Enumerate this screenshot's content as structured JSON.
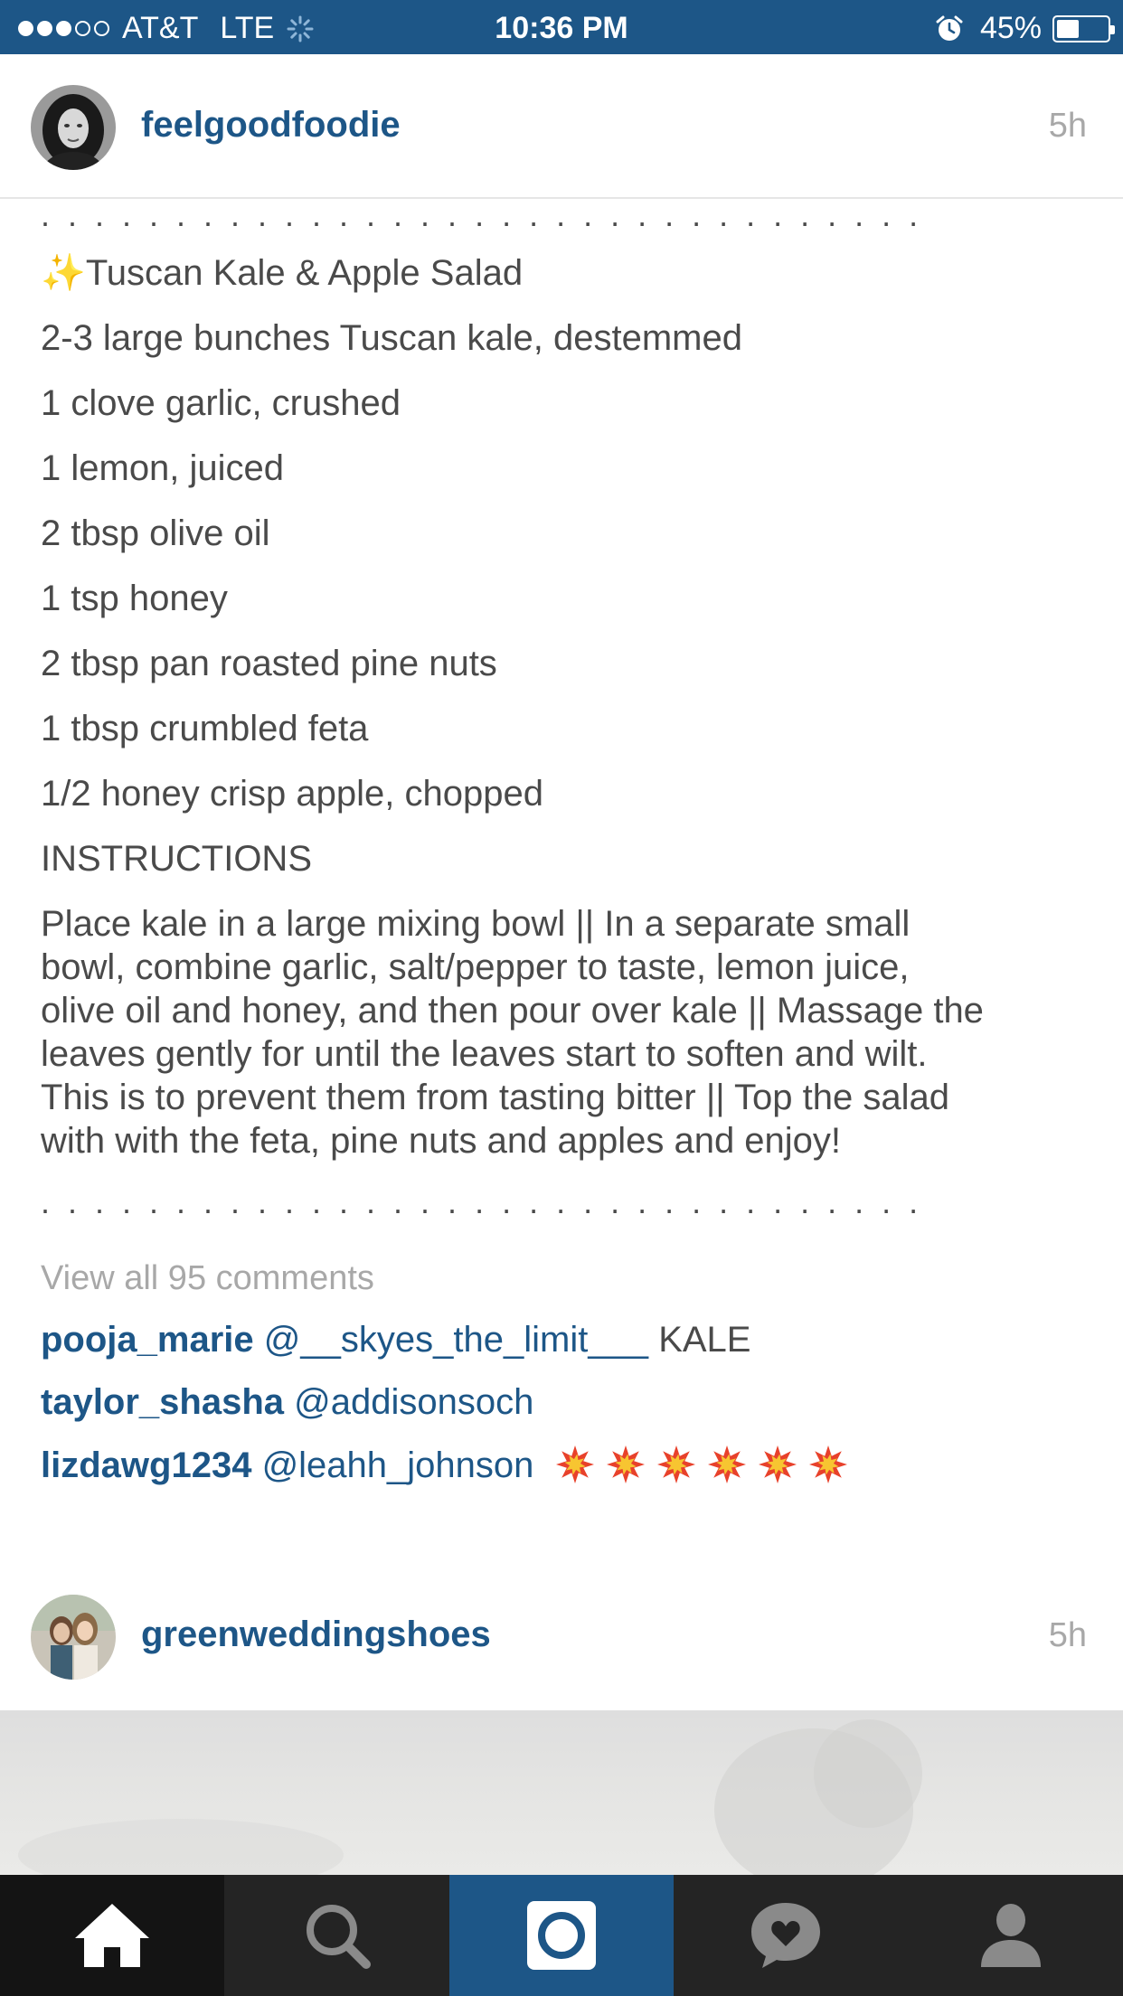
{
  "status_bar": {
    "signal_bars_filled": 3,
    "signal_bars_total": 5,
    "carrier": "AT&T",
    "network": "LTE",
    "time": "10:36 PM",
    "battery": "45%",
    "battery_level": 0.45,
    "icons": [
      "activity-spinner-icon",
      "alarm-clock-icon",
      "battery-icon"
    ]
  },
  "post": {
    "username": "feelgoodfoodie",
    "time_ago": "5h",
    "caption": {
      "dots": ". . . . . . . . . . . . . . . . . . . . . . . . . . . . . . . . .",
      "title_emoji": "✨",
      "title": "Tuscan Kale & Apple Salad",
      "ingredients": [
        "2-3 large bunches Tuscan kale, destemmed",
        "1 clove garlic, crushed",
        "1 lemon, juiced",
        "2 tbsp olive oil",
        "1 tsp honey",
        "2 tbsp pan roasted pine nuts",
        "1 tbsp crumbled feta",
        "1/2 honey crisp apple, chopped"
      ],
      "instructions_heading": "INSTRUCTIONS",
      "instructions_lines": [
        "Place kale in a large mixing bowl || In a separate small",
        "bowl, combine garlic, salt/pepper to taste, lemon juice,",
        "olive oil and honey, and then pour over kale || Massage the",
        "leaves gently for until the leaves start to soften and wilt.",
        "This is to prevent them from tasting bitter || Top the salad",
        "with with the feta, pine nuts and apples and enjoy!"
      ]
    },
    "view_all_comments": "View all 95 comments",
    "comments": [
      {
        "user": "pooja_marie",
        "mention": "@__skyes_the_limit___",
        "text": "KALE"
      },
      {
        "user": "taylor_shasha",
        "mention": "@addisonsoch",
        "text": ""
      },
      {
        "user": "lizdawg1234",
        "mention": "@leahh_johnson",
        "text": "",
        "emoji_count": 6,
        "emoji": "collision-icon"
      }
    ]
  },
  "next_post": {
    "username": "greenweddingshoes",
    "time_ago": "5h"
  },
  "tab_bar": {
    "tabs": [
      {
        "name": "home",
        "icon": "home-icon"
      },
      {
        "name": "search",
        "icon": "search-icon"
      },
      {
        "name": "camera",
        "icon": "camera-icon"
      },
      {
        "name": "activity",
        "icon": "heart-bubble-icon"
      },
      {
        "name": "profile",
        "icon": "profile-icon"
      }
    ]
  },
  "colors": {
    "brand_blue": "#1d5687",
    "text": "#4a4a4a",
    "muted": "#a8a8a8",
    "tab_bar": "#242424",
    "tab_active": "#141414"
  }
}
